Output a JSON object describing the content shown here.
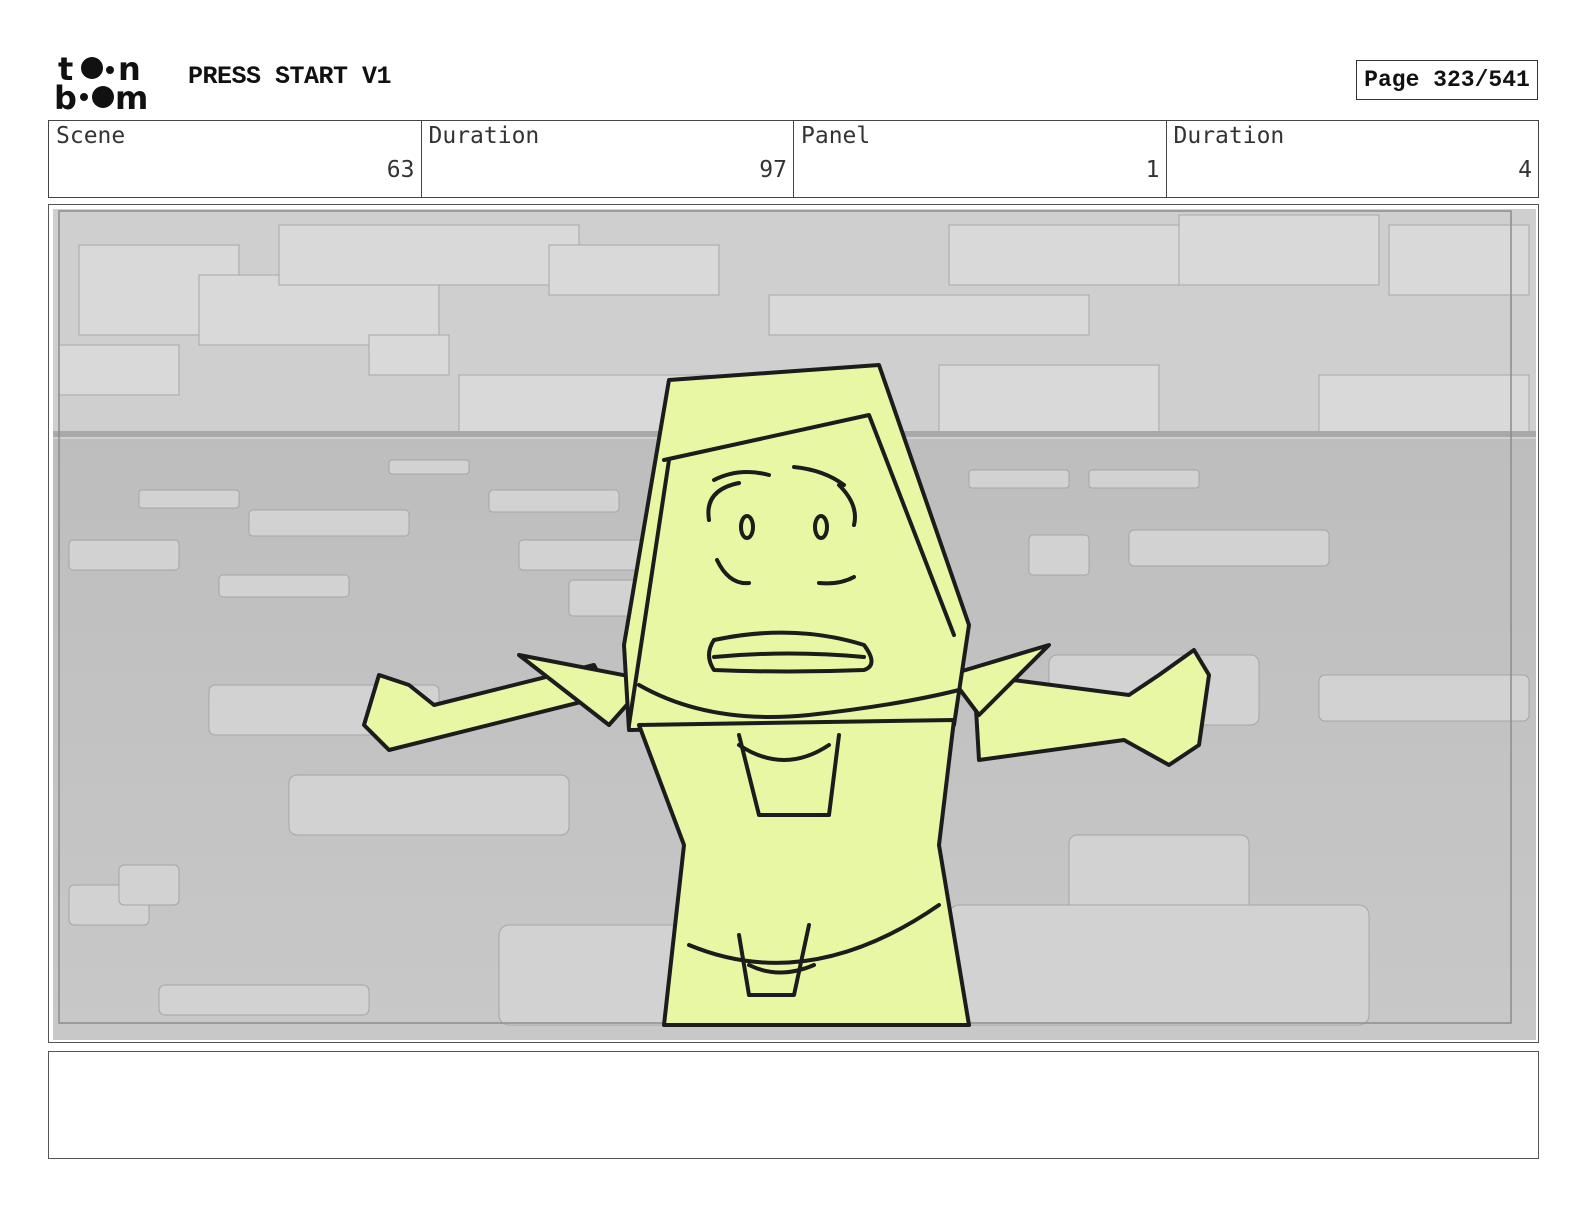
{
  "header": {
    "logo_text": "toonboom",
    "project_title": "PRESS START V1",
    "page_label": "Page 323/541"
  },
  "info": [
    {
      "label": "Scene",
      "value": "63"
    },
    {
      "label": "Duration",
      "value": "97"
    },
    {
      "label": "Panel",
      "value": "1"
    },
    {
      "label": "Duration",
      "value": "4"
    }
  ],
  "panel": {
    "description": "",
    "character_color": "#e8f7a4",
    "background_color": "#c4c4c4"
  },
  "notes": {
    "text": ""
  }
}
